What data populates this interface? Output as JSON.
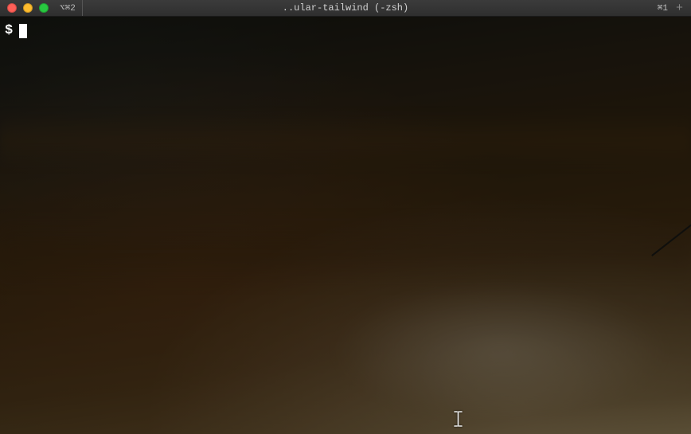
{
  "titlebar": {
    "window_title": "..ular-tailwind (-zsh)",
    "left_shortcut": "⌥⌘2",
    "right_shortcut": "⌘1",
    "plus": "+"
  },
  "terminal": {
    "prompt": "$",
    "input": ""
  }
}
